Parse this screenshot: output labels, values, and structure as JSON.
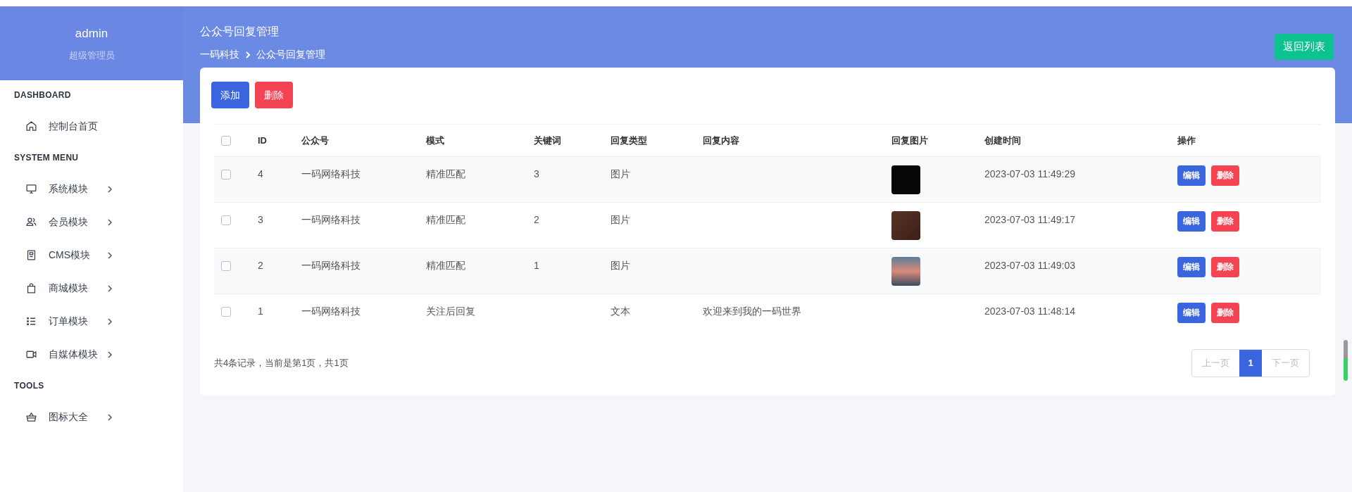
{
  "user": {
    "name": "admin",
    "role": "超级管理员"
  },
  "sidebar": {
    "sections": [
      {
        "title": "DASHBOARD",
        "items": [
          {
            "label": "控制台首页",
            "expandable": false
          }
        ]
      },
      {
        "title": "SYSTEM MENU",
        "items": [
          {
            "label": "系统模块",
            "expandable": true
          },
          {
            "label": "会员模块",
            "expandable": true
          },
          {
            "label": "CMS模块",
            "expandable": true
          },
          {
            "label": "商城模块",
            "expandable": true
          },
          {
            "label": "订单模块",
            "expandable": true
          },
          {
            "label": "自媒体模块",
            "expandable": true
          }
        ]
      },
      {
        "title": "TOOLS",
        "items": [
          {
            "label": "图标大全",
            "expandable": true
          }
        ]
      }
    ]
  },
  "page": {
    "title": "公众号回复管理",
    "breadcrumb": [
      "一码科技",
      "公众号回复管理"
    ],
    "back_button": "返回列表"
  },
  "toolbar": {
    "add_button": "添加",
    "delete_button": "删除"
  },
  "table": {
    "columns": [
      "ID",
      "公众号",
      "模式",
      "关键词",
      "回复类型",
      "回复内容",
      "回复图片",
      "创建时间",
      "操作"
    ],
    "rows": [
      {
        "checked": false,
        "id": "4",
        "account": "一码网络科技",
        "mode": "精准匹配",
        "keyword": "3",
        "reply_type": "图片",
        "reply_content": "",
        "has_image": true,
        "created": "2023-07-03 11:49:29",
        "edit": "编辑",
        "delete": "删除"
      },
      {
        "checked": false,
        "id": "3",
        "account": "一码网络科技",
        "mode": "精准匹配",
        "keyword": "2",
        "reply_type": "图片",
        "reply_content": "",
        "has_image": true,
        "created": "2023-07-03 11:49:17",
        "edit": "编辑",
        "delete": "删除"
      },
      {
        "checked": false,
        "id": "2",
        "account": "一码网络科技",
        "mode": "精准匹配",
        "keyword": "1",
        "reply_type": "图片",
        "reply_content": "",
        "has_image": true,
        "created": "2023-07-03 11:49:03",
        "edit": "编辑",
        "delete": "删除"
      },
      {
        "checked": false,
        "id": "1",
        "account": "一码网络科技",
        "mode": "关注后回复",
        "keyword": "",
        "reply_type": "文本",
        "reply_content": "欢迎来到我的一码世界",
        "has_image": false,
        "created": "2023-07-03 11:48:14",
        "edit": "编辑",
        "delete": "删除"
      }
    ],
    "header_checked": false
  },
  "pagination": {
    "summary": "共4条记录，当前是第1页，共1页",
    "prev": "上一页",
    "pages": [
      {
        "label": "1",
        "selected": true
      }
    ],
    "next": "下一页"
  }
}
